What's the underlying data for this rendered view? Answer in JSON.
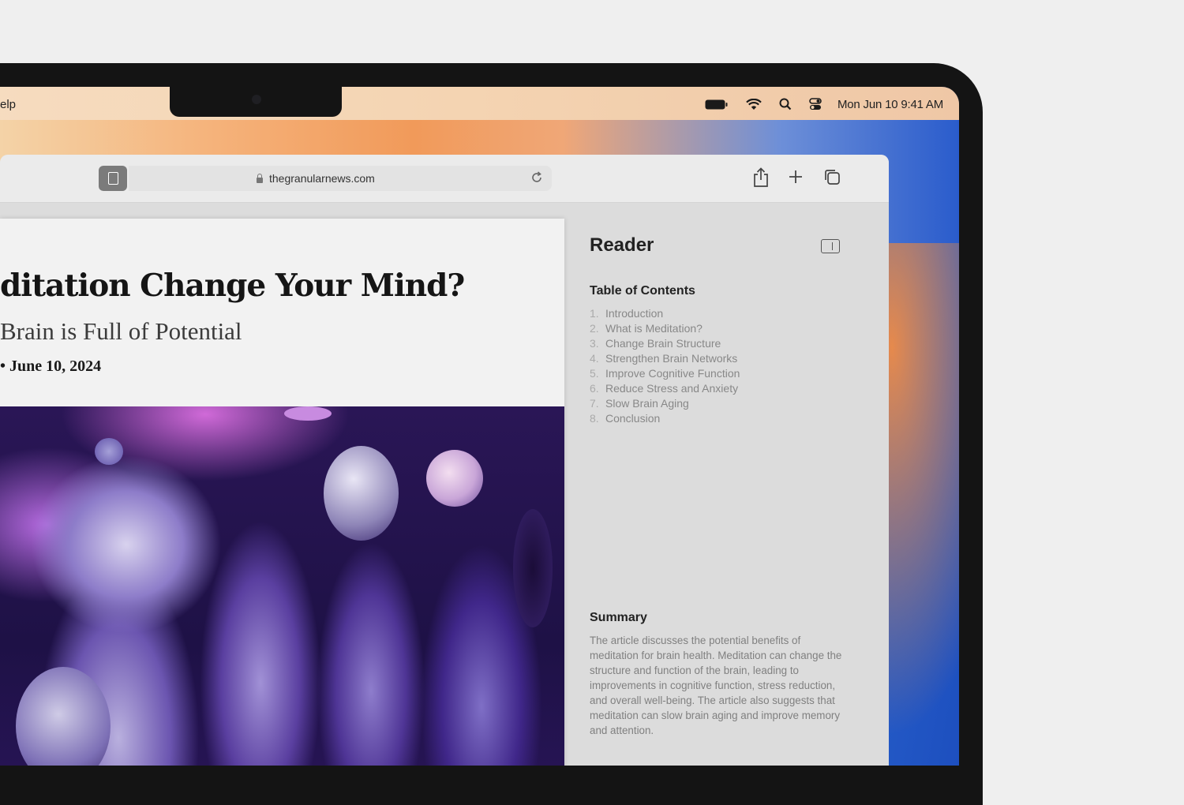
{
  "menubar": {
    "help_label": "elp",
    "clock": "Mon Jun 10  9:41 AM",
    "icons": [
      "battery-icon",
      "wifi-icon",
      "search-icon",
      "control-center-icon"
    ]
  },
  "browser": {
    "url": "thegranularnews.com",
    "icons": [
      "reader-icon",
      "lock-icon",
      "reload-icon",
      "share-icon",
      "new-tab-icon",
      "tabs-overview-icon"
    ]
  },
  "article": {
    "headline": "ditation Change Your Mind?",
    "subheadline": "Brain is Full of Potential",
    "date": "•  June 10, 2024"
  },
  "reader": {
    "title": "Reader",
    "toc_heading": "Table of Contents",
    "toc": [
      {
        "num": "1.",
        "label": "Introduction"
      },
      {
        "num": "2.",
        "label": "What is Meditation?"
      },
      {
        "num": "3.",
        "label": "Change Brain Structure"
      },
      {
        "num": "4.",
        "label": "Strengthen Brain Networks"
      },
      {
        "num": "5.",
        "label": "Improve Cognitive Function"
      },
      {
        "num": "6.",
        "label": "Reduce Stress and Anxiety"
      },
      {
        "num": "7.",
        "label": "Slow Brain Aging"
      },
      {
        "num": "8.",
        "label": "Conclusion"
      }
    ],
    "summary_heading": "Summary",
    "summary": "The article discusses the potential benefits of meditation for brain health. Meditation can change the structure and function of the brain, leading to improvements in cognitive function, stress reduction, and overall well-being. The article also suggests that meditation can slow brain aging and improve memory and attention."
  }
}
